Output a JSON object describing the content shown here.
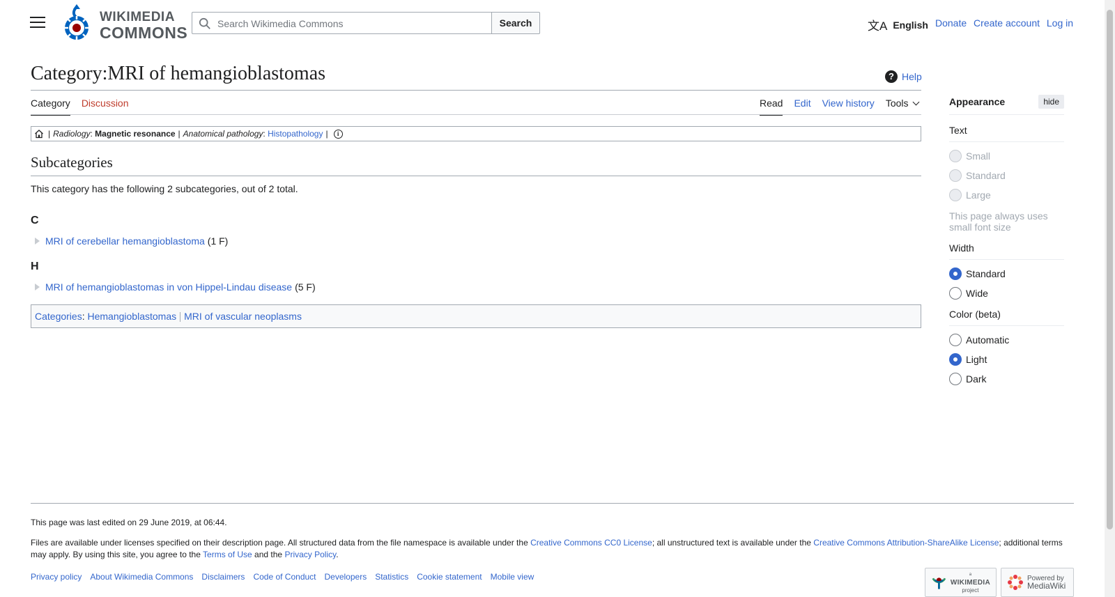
{
  "header": {
    "logo": {
      "line1": "WIKIMEDIA",
      "line2": "COMMONS"
    },
    "search": {
      "placeholder": "Search Wikimedia Commons",
      "value": "",
      "button_label": "Search"
    },
    "language": {
      "label": "English",
      "icon": "translate-icon"
    },
    "user_links": {
      "donate": "Donate",
      "create_account": "Create account",
      "log_in": "Log in"
    }
  },
  "page": {
    "title": "Category:MRI of hemangioblastomas",
    "help_label": "Help"
  },
  "tabs": {
    "left": [
      {
        "label": "Category",
        "selected": true
      },
      {
        "label": "Discussion",
        "selected": false
      }
    ],
    "right": [
      {
        "label": "Read",
        "selected": true
      },
      {
        "label": "Edit",
        "selected": false
      },
      {
        "label": "View history",
        "selected": false
      },
      {
        "label": "Tools",
        "selected": false
      }
    ]
  },
  "breadcrumb": {
    "sep": "|",
    "radiology_label": "Radiology",
    "radiology_value": "Magnetic resonance",
    "pathology_label": "Anatomical pathology",
    "pathology_value": "Histopathology"
  },
  "subcategories": {
    "heading": "Subcategories",
    "summary": "This category has the following 2 subcategories, out of 2 total.",
    "groups": [
      {
        "letter": "C",
        "items": [
          {
            "label": "MRI of cerebellar hemangioblastoma",
            "count": "(1 F)"
          }
        ]
      },
      {
        "letter": "H",
        "items": [
          {
            "label": "MRI of hemangioblastomas in von Hippel-Lindau disease",
            "count": "(5 F)"
          }
        ]
      }
    ]
  },
  "catlinks": {
    "label": "Categories",
    "items": [
      "Hemangioblastomas",
      "MRI of vascular neoplasms"
    ]
  },
  "appearance": {
    "title": "Appearance",
    "hide_label": "hide",
    "text_section": {
      "title": "Text",
      "options": [
        "Small",
        "Standard",
        "Large"
      ],
      "note": "This page always uses small font size"
    },
    "width_section": {
      "title": "Width",
      "options": [
        "Standard",
        "Wide"
      ],
      "selected": "Standard"
    },
    "color_section": {
      "title": "Color (beta)",
      "options": [
        "Automatic",
        "Light",
        "Dark"
      ],
      "selected": "Light"
    }
  },
  "footer": {
    "last_edited": "This page was last edited on 29 June 2019, at 06:44.",
    "license": {
      "t1": "Files are available under licenses specified on their description page. All structured data from the file namespace is available under the ",
      "l1": "Creative Commons CC0 License",
      "t2": "; all unstructured text is available under the ",
      "l2": "Creative Commons Attribution-ShareAlike License",
      "t3": "; additional terms may apply. By using this site, you agree to the ",
      "l3": "Terms of Use",
      "t4": " and the ",
      "l4": "Privacy Policy",
      "t5": "."
    },
    "links": [
      "Privacy policy",
      "About Wikimedia Commons",
      "Disclaimers",
      "Code of Conduct",
      "Developers",
      "Statistics",
      "Cookie statement",
      "Mobile view"
    ],
    "badges": {
      "wikimedia": {
        "small": "a",
        "name": "WIKIMEDIA",
        "sub": "project"
      },
      "mediawiki": {
        "line1": "Powered by",
        "line2": "MediaWiki"
      }
    }
  },
  "colors": {
    "link": "#3366cc",
    "link_new": "#bf3c2c",
    "text": "#202122",
    "border": "#a2a9b1",
    "logo_blue": "#0063bf",
    "logo_red": "#990000"
  }
}
